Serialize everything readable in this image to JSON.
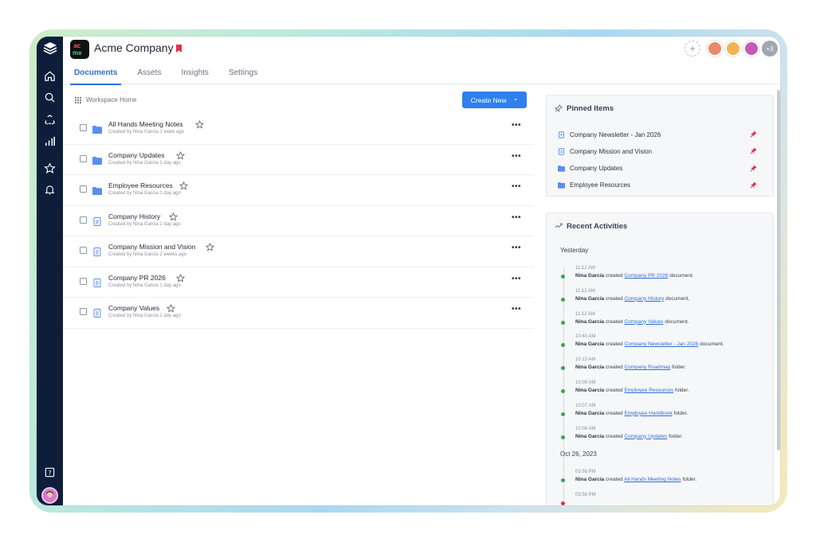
{
  "header": {
    "company_name": "Acme Company",
    "logo_letters": [
      "ac",
      "me"
    ],
    "tabs": [
      {
        "label": "Documents",
        "active": true
      },
      {
        "label": "Assets",
        "active": false
      },
      {
        "label": "Insights",
        "active": false
      },
      {
        "label": "Settings",
        "active": false
      }
    ],
    "add_member": "+",
    "more_members": "+3"
  },
  "sidebar": {
    "items": [
      {
        "icon": "home-icon"
      },
      {
        "icon": "search-icon"
      },
      {
        "icon": "recycle-icon"
      },
      {
        "icon": "chart-icon"
      },
      {
        "icon": "star-icon"
      },
      {
        "icon": "bell-icon"
      },
      {
        "icon": "help-icon"
      }
    ]
  },
  "breadcrumb": {
    "label": "Workspace Home"
  },
  "create_button": {
    "label": "Create New",
    "chevron": "⌄"
  },
  "documents": [
    {
      "type": "folder",
      "title": "All Hands Meeting Notes",
      "meta": "Created by Nina Garcia 1 week ago"
    },
    {
      "type": "folder",
      "title": "Company Updates",
      "meta": "Created by Nina Garcia 1 day ago"
    },
    {
      "type": "folder",
      "title": "Employee Resources",
      "meta": "Created by Nina Garcia 1 day ago"
    },
    {
      "type": "doc",
      "title": "Company History",
      "meta": "Created by Nina Garcia 1 day ago"
    },
    {
      "type": "doc",
      "title": "Company Mission and Vision",
      "meta": "Created by Nina Garcia 2 weeks ago"
    },
    {
      "type": "doc",
      "title": "Company PR 2026",
      "meta": "Created by Nina Garcia 1 day ago"
    },
    {
      "type": "doc",
      "title": "Company Values",
      "meta": "Created by Nina Garcia 1 day ago"
    }
  ],
  "row_menu": "•••",
  "pinned": {
    "title": "Pinned Items",
    "items": [
      {
        "type": "doc",
        "label": "Company Newsletter - Jan 2026"
      },
      {
        "type": "doc",
        "label": "Company Mission and Vision"
      },
      {
        "type": "folder",
        "label": "Company Updates"
      },
      {
        "type": "folder",
        "label": "Employee Resources"
      }
    ]
  },
  "activities": {
    "title": "Recent Activities",
    "groups": [
      {
        "date": "Yesterday",
        "items": [
          {
            "time": "11:12 AM",
            "user": "Nina Garcia",
            "verb": "created",
            "target": "Company PR 2026",
            "kind": "document."
          },
          {
            "time": "11:12 AM",
            "user": "Nina Garcia",
            "verb": "created",
            "target": "Company History",
            "kind": "document."
          },
          {
            "time": "11:12 AM",
            "user": "Nina Garcia",
            "verb": "created",
            "target": "Company Values",
            "kind": "document."
          },
          {
            "time": "10:40 AM",
            "user": "Nina Garcia",
            "verb": "created",
            "target": "Company Newsletter - Jan 2026",
            "kind": "document."
          },
          {
            "time": "10:13 AM",
            "user": "Nina Garcia",
            "verb": "created",
            "target": "Company Roadmap",
            "kind": "folder."
          },
          {
            "time": "10:09 AM",
            "user": "Nina Garcia",
            "verb": "created",
            "target": "Employee Resources",
            "kind": "folder."
          },
          {
            "time": "10:07 AM",
            "user": "Nina Garcia",
            "verb": "created",
            "target": "Employee Handbook",
            "kind": "folder."
          },
          {
            "time": "10:06 AM",
            "user": "Nina Garcia",
            "verb": "created",
            "target": "Company Updates",
            "kind": "folder."
          }
        ]
      },
      {
        "date": "Oct 26, 2023",
        "items": [
          {
            "time": "03:58 PM",
            "user": "Nina Garcia",
            "verb": "created",
            "target": "All Hands Meeting Notes",
            "kind": "folder."
          },
          {
            "time": "03:58 PM",
            "user": "",
            "verb": "",
            "target": "",
            "kind": ""
          }
        ]
      }
    ]
  },
  "colors": {
    "accent": "#2f6fd6",
    "button": "#2f80ed",
    "sidebar": "#0e1e3a",
    "pin": "#e0314b",
    "timeline_dot": "#34a853"
  }
}
